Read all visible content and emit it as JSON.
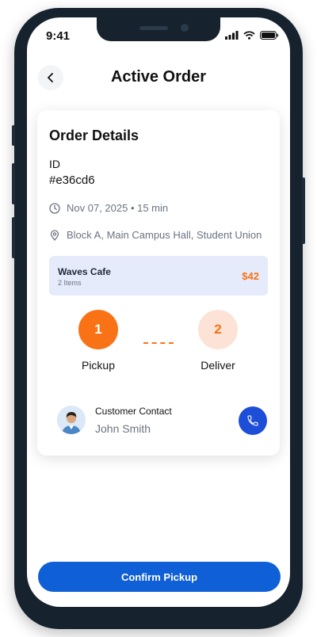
{
  "status_bar": {
    "time": "9:41",
    "icons": [
      "signal-icon",
      "wifi-icon",
      "battery-icon"
    ]
  },
  "header": {
    "title": "Active Order",
    "back_icon": "chevron-left-icon"
  },
  "order": {
    "section_title": "Order Details",
    "id_label": "ID",
    "id_value": "#e36cd6",
    "datetime": "Nov 07, 2025 • 15 min",
    "location": "Block A, Main Campus Hall, Student Union",
    "shop": {
      "name": "Waves Cafe",
      "items": "2 Items",
      "price": "$42"
    },
    "steps": [
      {
        "number": "1",
        "label": "Pickup",
        "state": "active"
      },
      {
        "number": "2",
        "label": "Deliver",
        "state": "pending"
      }
    ],
    "contact": {
      "label": "Customer Contact",
      "name": "John Smith"
    }
  },
  "actions": {
    "confirm_label": "Confirm Pickup"
  },
  "colors": {
    "primary": "#0f5fd6",
    "accent": "#f97316",
    "accent_light": "#fde3d6",
    "shop_bg": "#e5ebfb"
  }
}
